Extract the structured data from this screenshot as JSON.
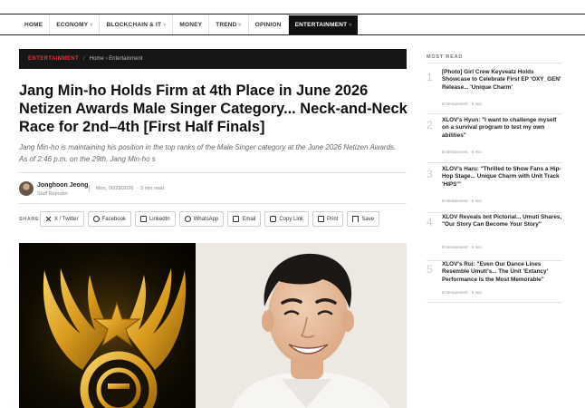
{
  "nav": {
    "items": [
      {
        "label": "HOME",
        "caret": ""
      },
      {
        "label": "ECONOMY",
        "caret": "˅"
      },
      {
        "label": "BLOCKCHAIN & IT",
        "caret": "˅"
      },
      {
        "label": "MONEY",
        "caret": ""
      },
      {
        "label": "TREND",
        "caret": "˅"
      },
      {
        "label": "OPINION",
        "caret": ""
      },
      {
        "label": "ENTERTAINMENT",
        "caret": "˅"
      }
    ],
    "active_index": 6
  },
  "breadcrumb": {
    "category": "ENTERTAINMENT",
    "separator": "/",
    "path": "Home › Entertainment"
  },
  "article": {
    "headline": "Jang Min-ho Holds Firm at 4th Place in June 2026 Netizen Awards Male Singer Category... Neck-and-Neck Race for 2nd–4th [First Half Finals]",
    "dek": "Jang Min-ho is maintaining his position in the top ranks of the Male Singer category at the June 2026 Netizen Awards. As of 2:46 p.m. on the 29th, Jang Min-ho s",
    "author": {
      "name": "Jonghoon Jeong",
      "role": "Staff Reporter"
    },
    "date": "Mon, 06/29/2026",
    "dot": "·",
    "read_time": "3 min read"
  },
  "share": {
    "label": "SHARE",
    "buttons": [
      {
        "label": "X / Twitter",
        "icon": "x-icon"
      },
      {
        "label": "Facebook",
        "icon": "facebook-icon"
      },
      {
        "label": "LinkedIn",
        "icon": "linkedin-icon"
      },
      {
        "label": "WhatsApp",
        "icon": "whatsapp-icon"
      },
      {
        "label": "Email",
        "icon": "email-icon"
      },
      {
        "label": "Copy Link",
        "icon": "link-icon"
      },
      {
        "label": "Print",
        "icon": "print-icon"
      },
      {
        "label": "Save",
        "icon": "bookmark-icon"
      }
    ]
  },
  "sidebar": {
    "title": "MOST READ",
    "items": [
      {
        "num": "1",
        "headline": "[Photo] Girl Crew Keyveatz Holds Showcase to Celebrate First EP 'OXY_GEN' Release... 'Unique Charm'",
        "meta": "Entertainment · 5 min"
      },
      {
        "num": "2",
        "headline": "XLOV's Hyun: \"I want to challenge myself on a survival program to test my own abilities\"",
        "meta": "Entertainment · 5 min"
      },
      {
        "num": "3",
        "headline": "XLOV's Haru: \"Thrilled to Show Fans a Hip-Hop Stage... Unique Charm with Unit Track 'HIPS'\"",
        "meta": "Entertainment · 5 min"
      },
      {
        "num": "4",
        "headline": "XLOV Reveals bnt Pictorial... Umuti Shares, \"Our Story Can Become Your Story\"",
        "meta": "Entertainment · 5 min"
      },
      {
        "num": "5",
        "headline": "XLOV's Rui: \"Even Our Dance Lines Resemble Umuti's... The Unit 'Extancy' Performance Is the Most Memorable\"",
        "meta": "Entertainment · 5 min"
      }
    ]
  },
  "colors": {
    "accent_red": "#e0363c",
    "dark_bar": "#161616",
    "gold": "#e0a423"
  }
}
